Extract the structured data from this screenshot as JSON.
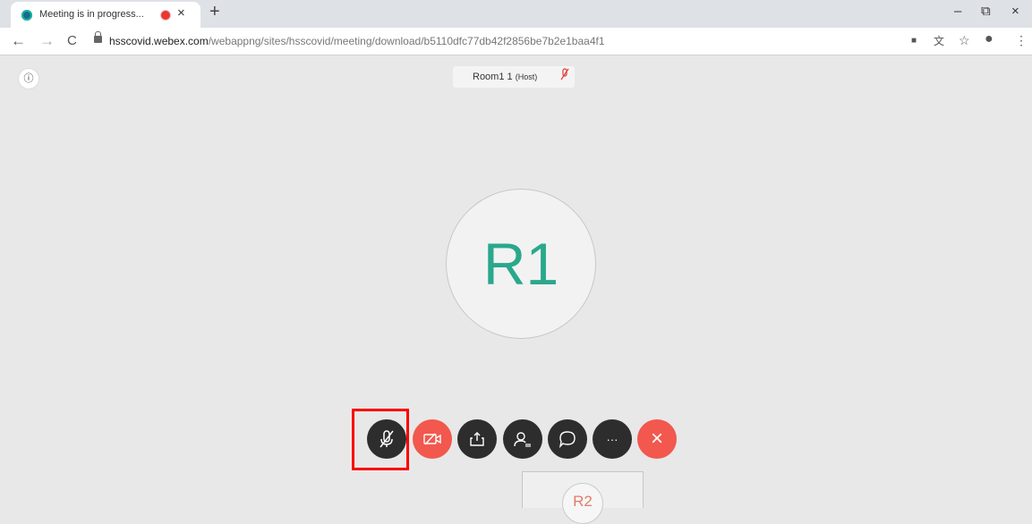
{
  "browser": {
    "tab_title": "Meeting is in progress...",
    "tab_close": "×",
    "new_tab": "+",
    "url_host": "hsscovid.webex.com",
    "url_path": "/webappng/sites/hsscovid/meeting/download/b5110dfc77db42f2856be7b2e1baa4f1",
    "back": "←",
    "forward": "→",
    "reload": "C",
    "window_minimize": "–",
    "window_restore": "⧉",
    "window_close": "×"
  },
  "meeting": {
    "info_icon": "ⓘ",
    "host_name": "Room1 1",
    "host_role": "(Host)",
    "avatar_initials": "R1",
    "self_initials": "R2"
  },
  "controls": {
    "mute": "mic-muted-icon",
    "video": "video-off-icon",
    "share": "share-icon",
    "participants": "participants-icon",
    "chat": "chat-icon",
    "more": "···",
    "end": "×"
  },
  "colors": {
    "accent": "#2aa88c",
    "danger": "#f2584d",
    "control_bg": "#2d2d2d",
    "highlight": "#ff0000"
  }
}
